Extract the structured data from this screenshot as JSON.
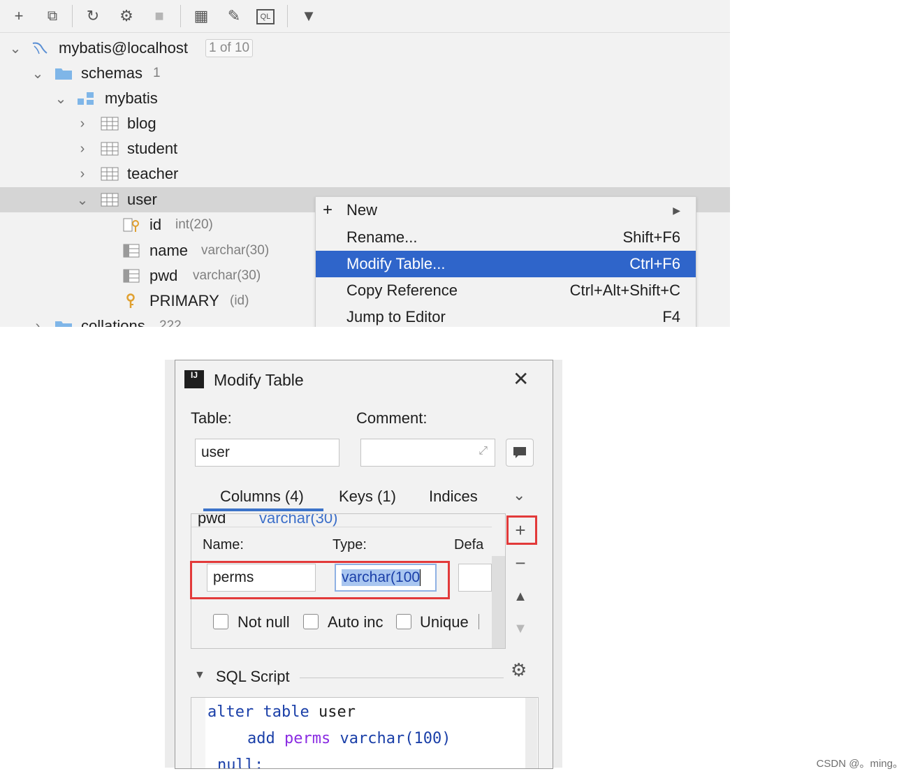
{
  "toolbar": {
    "buttons": [
      {
        "icon": "add-icon",
        "glyph": "+"
      },
      {
        "icon": "duplicate-icon",
        "glyph": "⧉"
      },
      {
        "icon": "refresh-icon",
        "glyph": "↻"
      },
      {
        "icon": "schema-sync-icon",
        "glyph": "⚙"
      },
      {
        "icon": "stop-icon",
        "glyph": "■"
      },
      {
        "icon": "table-view-icon",
        "glyph": "▦"
      },
      {
        "icon": "edit-icon",
        "glyph": "✎"
      },
      {
        "icon": "sql-console-icon",
        "glyph": "QL"
      },
      {
        "icon": "filter-icon",
        "glyph": "▼"
      }
    ]
  },
  "tree": {
    "connection": {
      "label": "mybatis@localhost",
      "badge": "1 of 10"
    },
    "schemas": {
      "label": "schemas",
      "count": "1"
    },
    "schema": {
      "label": "mybatis"
    },
    "tables": [
      "blog",
      "student",
      "teacher"
    ],
    "selected_table": "user",
    "columns": [
      {
        "name": "id",
        "type": "int(20)"
      },
      {
        "name": "name",
        "type": "varchar(30)"
      },
      {
        "name": "pwd",
        "type": "varchar(30)"
      }
    ],
    "key": {
      "name": "PRIMARY",
      "detail": "(id)"
    },
    "collations": {
      "label": "collations",
      "count": "222"
    }
  },
  "context_menu": {
    "items": [
      {
        "label": "New",
        "shortcut": "",
        "submenu": true
      },
      {
        "label": "Rename...",
        "shortcut": "Shift+F6"
      },
      {
        "label": "Modify Table...",
        "shortcut": "Ctrl+F6",
        "active": true
      },
      {
        "label": "Copy Reference",
        "shortcut": "Ctrl+Alt+Shift+C"
      },
      {
        "label": "Jump to Editor",
        "shortcut": "F4"
      }
    ]
  },
  "dialog": {
    "title": "Modify Table",
    "app_icon": "IJ",
    "table_label": "Table:",
    "table_value": "user",
    "comment_label": "Comment:",
    "comment_value": "",
    "tabs": [
      "Columns (4)",
      "Keys (1)",
      "Indices"
    ],
    "prev_row": {
      "name": "pwd",
      "type": "varchar(30)"
    },
    "name_label": "Name:",
    "type_label": "Type:",
    "default_label": "Defa",
    "name_value": "perms",
    "type_value": "varchar(100",
    "checkboxes": [
      "Not null",
      "Auto inc",
      "Unique"
    ],
    "sql_section": "SQL Script",
    "sql_lines": {
      "l1_kw1": "alter",
      "l1_kw2": "table",
      "l1_ident": "user",
      "l2_kw": "add",
      "l2_ident": "perms",
      "l2_type": "varchar(",
      "l2_num": "100",
      "l2_close": ")",
      "l3_kw": "null;"
    }
  },
  "watermark": "CSDN @。ming。"
}
